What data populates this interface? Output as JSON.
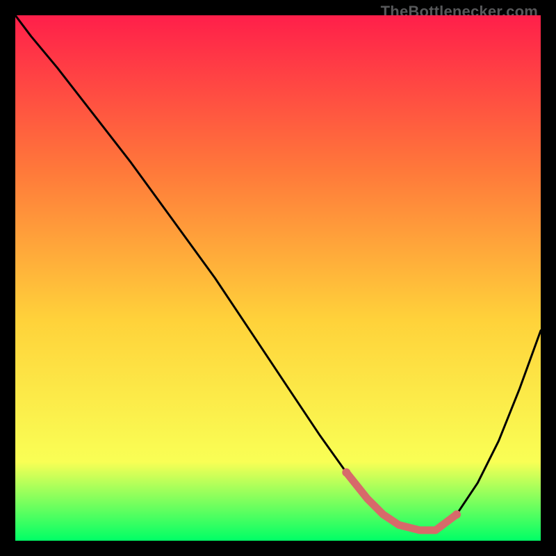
{
  "watermark": "TheBottlenecker.com",
  "chart_data": {
    "type": "line",
    "title": "",
    "xlabel": "",
    "ylabel": "",
    "xlim": [
      0,
      100
    ],
    "ylim": [
      0,
      100
    ],
    "grid": false,
    "legend": false,
    "background_gradient": {
      "top": "#ff1f4a",
      "mid_upper": "#ff7a3a",
      "mid": "#ffd23a",
      "mid_lower": "#f9ff55",
      "bottom": "#00ff66"
    },
    "series": [
      {
        "name": "curve",
        "color": "#000000",
        "x": [
          0,
          3,
          8,
          15,
          22,
          30,
          38,
          46,
          52,
          58,
          63,
          67,
          70,
          73,
          77,
          80,
          84,
          88,
          92,
          96,
          100
        ],
        "y": [
          100,
          96,
          90,
          81,
          72,
          61,
          50,
          38,
          29,
          20,
          13,
          8,
          5,
          3,
          2,
          2,
          5,
          11,
          19,
          29,
          40
        ]
      },
      {
        "name": "valley-highlight",
        "color": "#d76a6a",
        "style": "thick",
        "x": [
          63,
          67,
          70,
          73,
          77,
          80,
          84
        ],
        "y": [
          13,
          8,
          5,
          3,
          2,
          2,
          5
        ]
      }
    ]
  }
}
